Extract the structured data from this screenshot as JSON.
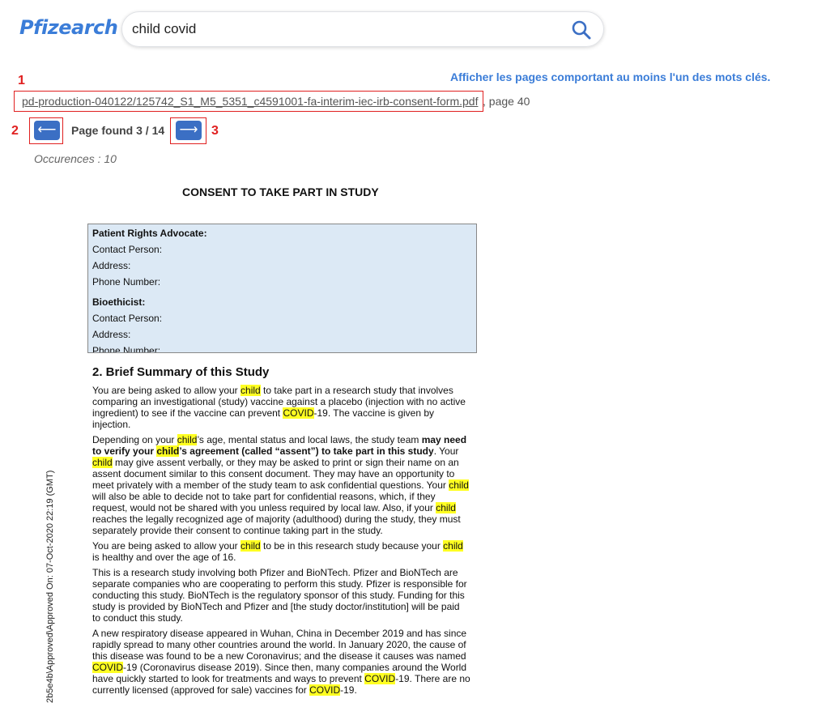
{
  "header": {
    "logo_text": "Pfizearch",
    "search_value": "child covid",
    "search_icon": "search-icon",
    "any_words_link": "Afficher les pages comportant au moins l'un des mots clés."
  },
  "markers": [
    "1",
    "2",
    "3"
  ],
  "result": {
    "file_link": "pd-production-040122/125742_S1_M5_5351_c4591001-fa-interim-iec-irb-consent-form.pdf",
    "page_suffix": ", page 40",
    "prev_label": "⟵",
    "next_label": "⟶",
    "page_found": "Page found 3 / 14",
    "occurences": "Occurences : 10"
  },
  "document": {
    "title": "CONSENT TO TAKE PART IN STUDY",
    "contact_box": [
      {
        "text": "Patient Rights Advocate:",
        "bold": true
      },
      {
        "text": "Contact Person:",
        "bold": false
      },
      {
        "text": "Address:",
        "bold": false
      },
      {
        "text": "Phone Number:",
        "bold": false
      },
      {
        "text": "Bioethicist:",
        "bold": true
      },
      {
        "text": "Contact Person:",
        "bold": false
      },
      {
        "text": "Address:",
        "bold": false
      },
      {
        "text": "Phone Number:",
        "bold": false
      }
    ],
    "section_heading": "2. Brief Summary of this Study",
    "paragraphs": [
      [
        [
          {
            "t": "You are being asked to allow your "
          },
          {
            "t": "child",
            "h": true
          },
          {
            "t": " to take part in a research study that involves"
          }
        ],
        [
          {
            "t": "comparing an investigational (study) vaccine against a placebo (injection with no active"
          }
        ],
        [
          {
            "t": "ingredient) to see if the vaccine can prevent "
          },
          {
            "t": "COVID",
            "h": true
          },
          {
            "t": "-19. The vaccine is given by"
          }
        ],
        [
          {
            "t": "injection."
          }
        ]
      ],
      [
        [
          {
            "t": "Depending on your "
          },
          {
            "t": "child",
            "h": true
          },
          {
            "t": "’s age, mental status and local laws, the study team "
          },
          {
            "t": "may need",
            "b": true
          }
        ],
        [
          {
            "t": "to verify your ",
            "b": true
          },
          {
            "t": "child",
            "h": true,
            "b": true
          },
          {
            "t": "’s agreement (called “assent”) to take part in this study",
            "b": true
          },
          {
            "t": ". Your"
          }
        ],
        [
          {
            "t": "child",
            "h": true
          },
          {
            "t": " may give assent verbally, or they may be asked to print or sign their name on an"
          }
        ],
        [
          {
            "t": "assent document similar to this consent document. They may have an opportunity to"
          }
        ],
        [
          {
            "t": "meet privately with a member of the study team to ask confidential questions. Your "
          },
          {
            "t": "child",
            "h": true
          }
        ],
        [
          {
            "t": "will also be able to decide not to take part for confidential reasons, which, if they"
          }
        ],
        [
          {
            "t": "request, would not be shared with you unless required by local law. Also, if your "
          },
          {
            "t": "child",
            "h": true
          }
        ],
        [
          {
            "t": "reaches the legally recognized age of majority (adulthood) during the study, they must"
          }
        ],
        [
          {
            "t": "separately provide their consent to continue taking part in the study."
          }
        ]
      ],
      [
        [
          {
            "t": "You are being asked to allow your "
          },
          {
            "t": "child",
            "h": true
          },
          {
            "t": " to be in this research study because your "
          },
          {
            "t": "child",
            "h": true
          }
        ],
        [
          {
            "t": "is healthy and over the age of 16."
          }
        ]
      ],
      [
        [
          {
            "t": "This is a research study involving both Pfizer and BioNTech. Pfizer and BioNTech are"
          }
        ],
        [
          {
            "t": "separate companies who are cooperating to perform this study. Pfizer is responsible for"
          }
        ],
        [
          {
            "t": "conducting this study. BioNTech is the regulatory sponsor of this study. Funding for this"
          }
        ],
        [
          {
            "t": "study is provided by BioNTech and Pfizer and [the study doctor/institution] will be paid"
          }
        ],
        [
          {
            "t": "to conduct this study."
          }
        ]
      ],
      [
        [
          {
            "t": "A new respiratory disease appeared in Wuhan, China in December 2019 and has since"
          }
        ],
        [
          {
            "t": "rapidly spread to many other countries around the world. In January 2020, the cause of"
          }
        ],
        [
          {
            "t": "this disease was found to be a new Coronavirus; and the disease it causes was named"
          }
        ],
        [
          {
            "t": "COVID",
            "h": true
          },
          {
            "t": "-19 (Coronavirus disease 2019). Since then, many companies around the World"
          }
        ],
        [
          {
            "t": "have quickly started to look for treatments and ways to prevent "
          },
          {
            "t": "COVID",
            "h": true
          },
          {
            "t": "-19. There are no"
          }
        ],
        [
          {
            "t": "currently licensed (approved for sale) vaccines for "
          },
          {
            "t": "COVID",
            "h": true
          },
          {
            "t": "-19."
          }
        ]
      ]
    ],
    "side_stamp": "2b5e4b\\Approved\\Approved On: 07-Oct-2020 22:19 (GMT)"
  }
}
